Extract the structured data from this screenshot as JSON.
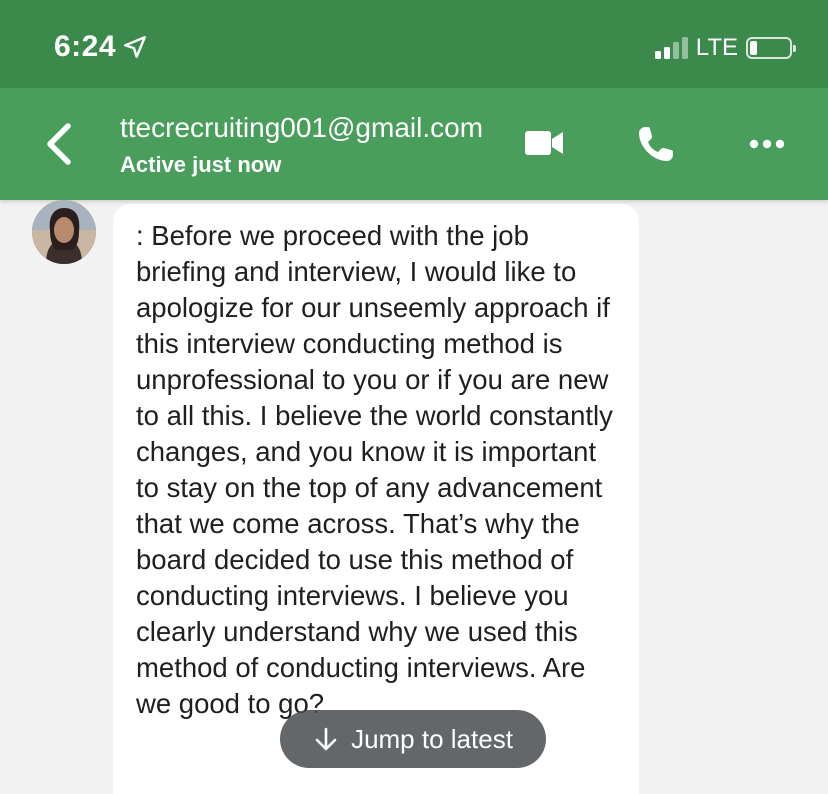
{
  "status_bar": {
    "time": "6:24",
    "network": "LTE"
  },
  "header": {
    "contact": "ttecrecruiting001@gmail.com",
    "status": "Active just now"
  },
  "message": {
    "text": ": Before we proceed with the job briefing and interview, I would like to apologize for our unseemly approach if this interview conducting method is unprofessional to you or if you are new to all this. I believe the world constantly changes, and you know it is important to stay on the top of any advancement that we come across. That’s why the board decided to use this method of conducting interviews. I believe you clearly understand why we used this method of conducting interviews. Are we good to go?"
  },
  "jump_button": {
    "label": "Jump to latest"
  },
  "colors": {
    "status_bar": "#3b8a4c",
    "header": "#4a9e5c",
    "background": "#f2f2f2",
    "bubble": "#ffffff"
  }
}
